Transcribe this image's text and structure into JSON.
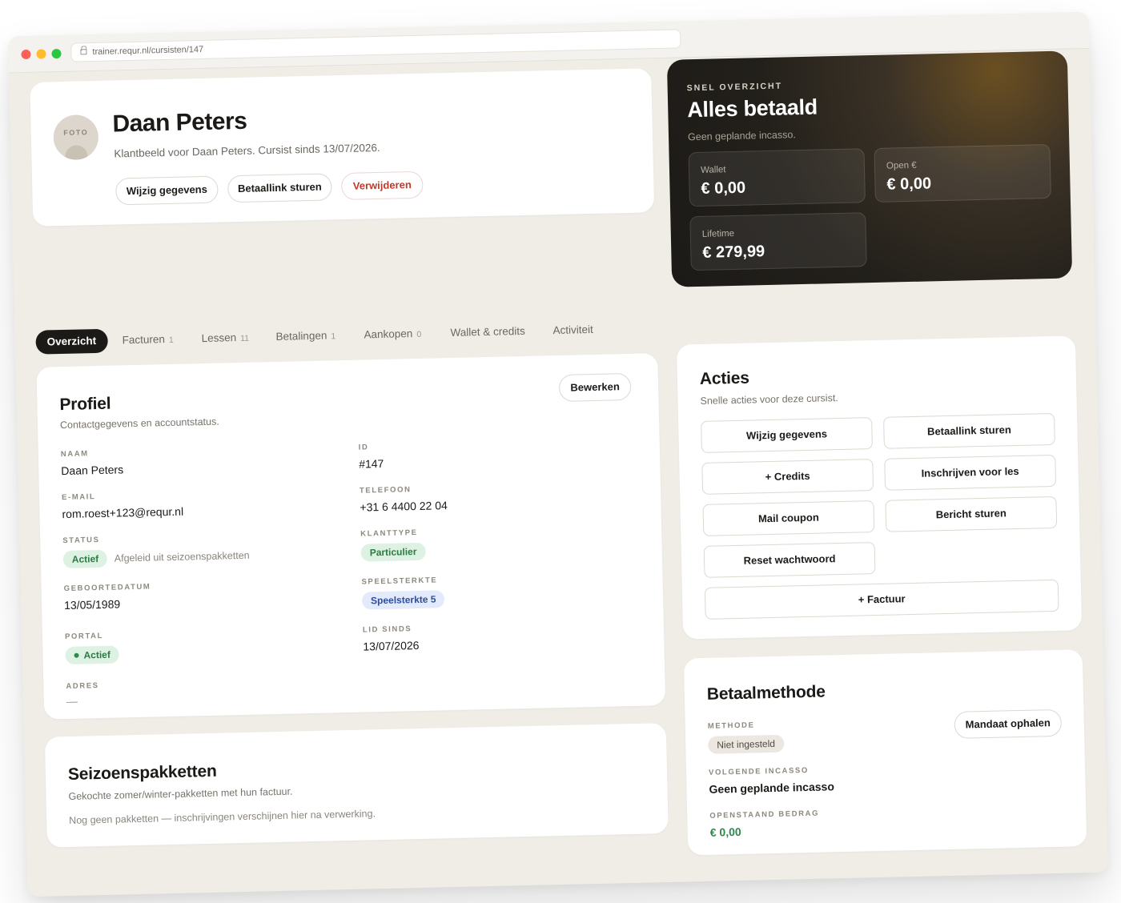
{
  "browser": {
    "url": "trainer.requr.nl/cursisten/147"
  },
  "header": {
    "avatar_label": "FOTO",
    "name": "Daan Peters",
    "subline": "Klantbeeld voor Daan Peters. Cursist sinds 13/07/2026.",
    "buttons": {
      "edit": "Wijzig gegevens",
      "paylink": "Betaallink sturen",
      "delete": "Verwijderen"
    }
  },
  "overview": {
    "eyebrow": "SNEL OVERZICHT",
    "title": "Alles betaald",
    "subtitle": "Geen geplande incasso.",
    "stats": [
      {
        "label": "Wallet",
        "value": "€ 0,00"
      },
      {
        "label": "Open €",
        "value": "€ 0,00"
      },
      {
        "label": "Lifetime",
        "value": "€ 279,99"
      }
    ]
  },
  "tabs": [
    {
      "label": "Overzicht",
      "count": ""
    },
    {
      "label": "Facturen",
      "count": "1"
    },
    {
      "label": "Lessen",
      "count": "11"
    },
    {
      "label": "Betalingen",
      "count": "1"
    },
    {
      "label": "Aankopen",
      "count": "0"
    },
    {
      "label": "Wallet & credits",
      "count": ""
    },
    {
      "label": "Activiteit",
      "count": ""
    }
  ],
  "profile": {
    "title": "Profiel",
    "subtitle": "Contactgegevens en accountstatus.",
    "edit_button": "Bewerken",
    "fields": {
      "naam": {
        "label": "NAAM",
        "value": "Daan Peters"
      },
      "email": {
        "label": "E-MAIL",
        "value": "rom.roest+123@requr.nl"
      },
      "status": {
        "label": "STATUS",
        "badge": "Actief",
        "note": "Afgeleid uit seizoenspakketten"
      },
      "geboortedatum": {
        "label": "GEBOORTEDATUM",
        "value": "13/05/1989"
      },
      "portal": {
        "label": "PORTAL",
        "badge": "Actief"
      },
      "adres": {
        "label": "ADRES",
        "value": "—"
      },
      "id": {
        "label": "ID",
        "value": "#147"
      },
      "telefoon": {
        "label": "TELEFOON",
        "value": "+31 6 4400 22 04"
      },
      "klanttype": {
        "label": "KLANTTYPE",
        "badge": "Particulier"
      },
      "speelsterkte": {
        "label": "SPEELSTERKTE",
        "badge": "Speelsterkte 5"
      },
      "lid_sinds": {
        "label": "LID SINDS",
        "value": "13/07/2026"
      }
    }
  },
  "season": {
    "title": "Seizoenspakketten",
    "subtitle": "Gekochte zomer/winter-pakketten met hun factuur.",
    "empty": "Nog geen pakketten — inschrijvingen verschijnen hier na verwerking."
  },
  "actions": {
    "title": "Acties",
    "subtitle": "Snelle acties voor deze cursist.",
    "buttons": {
      "edit": "Wijzig gegevens",
      "paylink": "Betaallink sturen",
      "credits": "+ Credits",
      "enroll": "Inschrijven voor les",
      "coupon": "Mail coupon",
      "message": "Bericht sturen",
      "reset": "Reset wachtwoord",
      "invoice": "+ Factuur"
    }
  },
  "payment": {
    "title": "Betaalmethode",
    "mandate_button": "Mandaat ophalen",
    "method_label": "METHODE",
    "method_badge": "Niet ingesteld",
    "next_label": "VOLGENDE INCASSO",
    "next_value": "Geen geplande incasso",
    "open_label": "OPENSTAAND BEDRAG",
    "open_value": "€ 0,00"
  },
  "colors": {
    "page_bg": "#f0ede7",
    "accent_dark": "#1c1a17",
    "danger": "#c0392b",
    "success": "#2d8a4a",
    "info": "#2e4d9c"
  }
}
